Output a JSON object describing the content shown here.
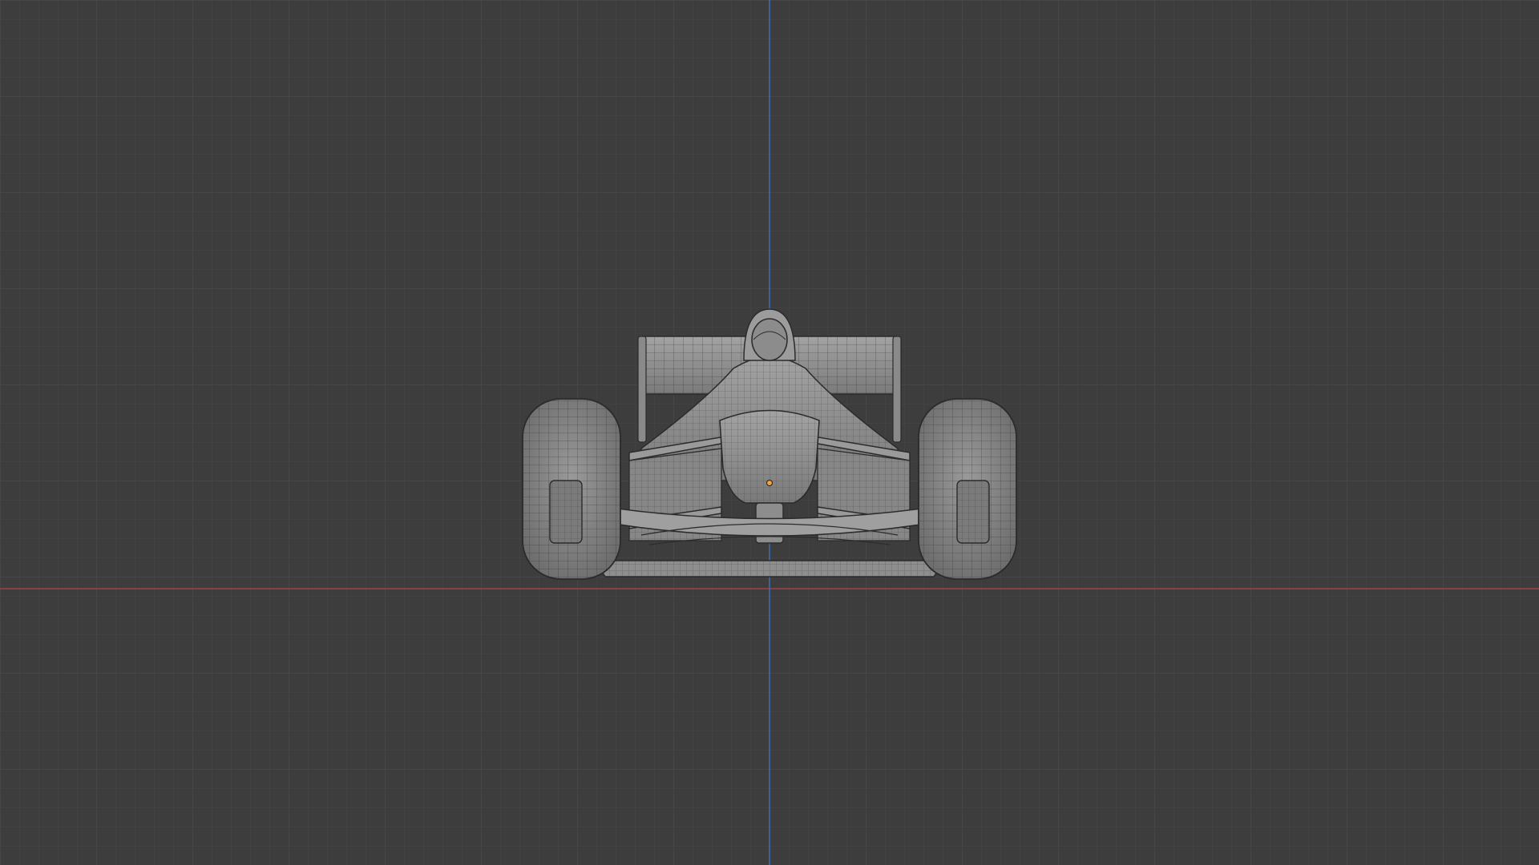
{
  "viewport": {
    "view": "front-orthographic",
    "shading": "solid",
    "overlay": "wireframe",
    "grid": true,
    "background_color": "#3d3d3d",
    "grid_minor_color": "#474747",
    "grid_major_color": "#505050",
    "x_axis_color": "#a0424a",
    "z_axis_color": "#3d6fb3",
    "object_origin_color": "#f2a33a"
  },
  "object": {
    "type": "mesh",
    "depicts": "formula-race-car",
    "mesh_color": "#8f8f8f",
    "wire_color": "#2b2b2b"
  }
}
